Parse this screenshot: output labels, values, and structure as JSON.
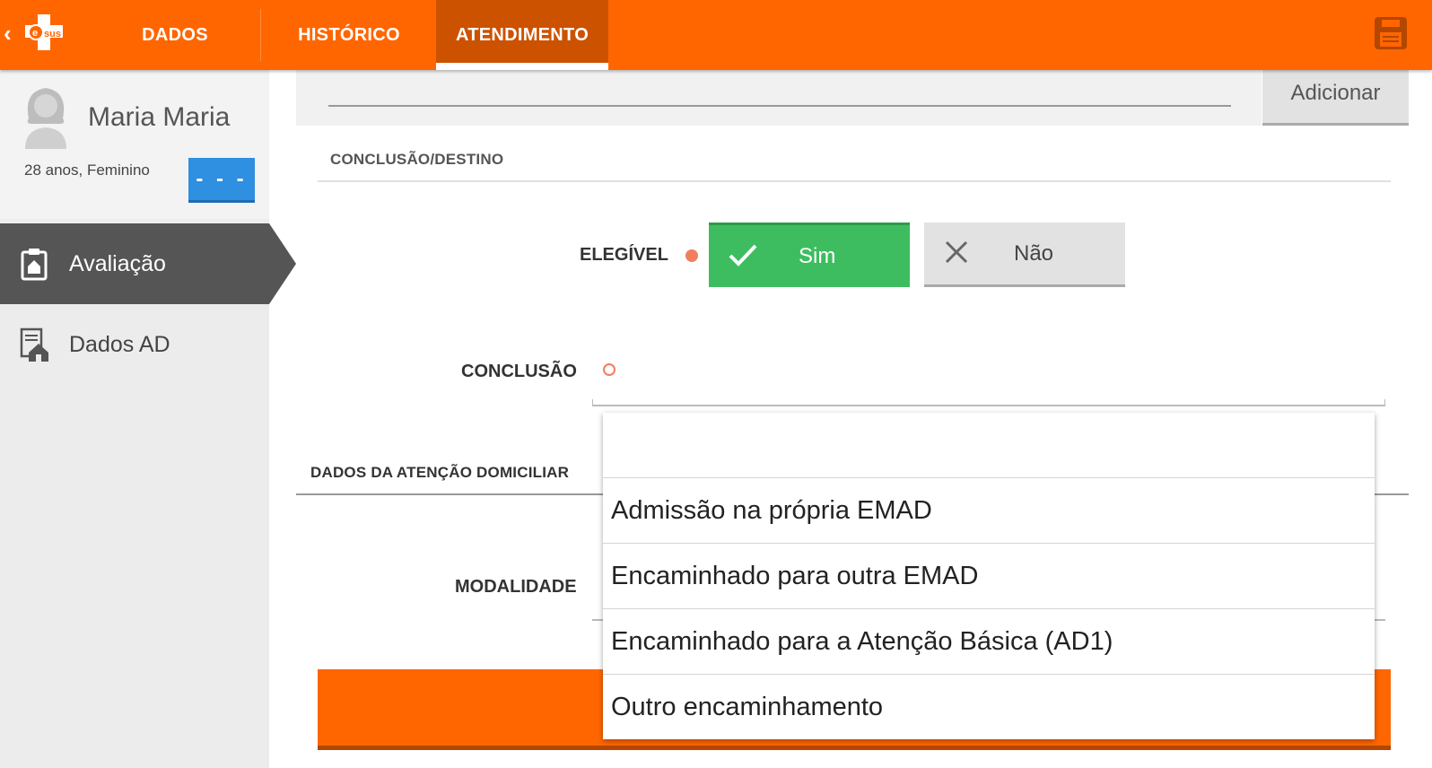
{
  "colors": {
    "primary": "#ff6600",
    "active_tab": "#cc5200",
    "success": "#3dbd5f",
    "required": "#f07f5f",
    "badge_blue": "#2f8fe0",
    "sidebar_active": "#555555"
  },
  "topbar": {
    "back_icon": "chevron-left-icon",
    "logo_text": "sus",
    "tabs": [
      {
        "label": "DADOS",
        "active": false
      },
      {
        "label": "HISTÓRICO",
        "active": false
      },
      {
        "label": "ATENDIMENTO",
        "active": true
      }
    ],
    "save_icon": "save-icon"
  },
  "patient": {
    "name": "Maria Maria",
    "info": "28 anos, Feminino",
    "badge_label": "- - -"
  },
  "sidebar": {
    "items": [
      {
        "label": "Avaliação",
        "icon": "clipboard-home-icon",
        "active": true
      },
      {
        "label": "Dados AD",
        "icon": "home-document-icon",
        "active": false
      }
    ]
  },
  "main": {
    "add_button_label": "Adicionar",
    "section_conclusao": "CONCLUSÃO/DESTINO",
    "elegivel": {
      "label": "ELEGÍVEL",
      "yes_label": "Sim",
      "no_label": "Não",
      "selected": "Sim"
    },
    "conclusao_label": "CONCLUSÃO",
    "section_dados_ad": "DADOS DA ATENÇÃO DOMICILIAR",
    "modalidade_label": "MODALIDADE"
  },
  "dropdown": {
    "options": [
      "",
      "Admissão na própria EMAD",
      "Encaminhado para outra EMAD",
      "Encaminhado para a Atenção Básica (AD1)",
      "Outro encaminhamento"
    ]
  }
}
